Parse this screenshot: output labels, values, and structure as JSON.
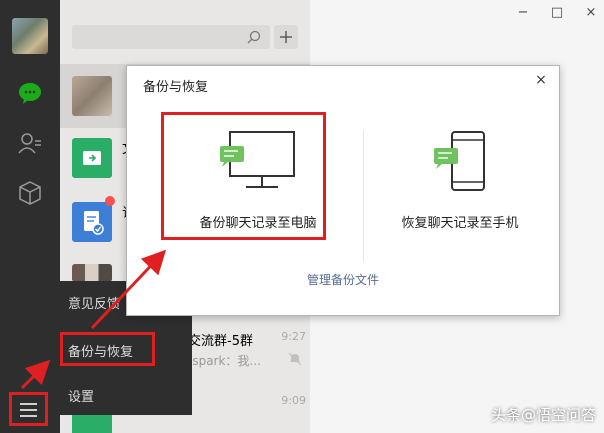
{
  "sidebar": {
    "icons": [
      "chat-icon",
      "contacts-icon",
      "favorites-icon",
      "menu-icon"
    ]
  },
  "conversations": [
    {
      "name": "",
      "preview": "",
      "time": ""
    },
    {
      "name": "文",
      "preview": "",
      "time": ""
    },
    {
      "name": "订",
      "preview": "",
      "time": ""
    },
    {
      "name": "",
      "preview": "",
      "time": ""
    },
    {
      "name": "交流群-5群",
      "preview": "-spark：我...",
      "time": "9:27"
    },
    {
      "name": "",
      "preview": "",
      "time": "9:09"
    }
  ],
  "popup_menu": {
    "items": [
      "意见反馈",
      "备份与恢复",
      "设置"
    ]
  },
  "dialog": {
    "title": "备份与恢复",
    "close": "×",
    "option_pc": "备份聊天记录至电脑",
    "option_phone": "恢复聊天记录至手机",
    "manage_link": "管理备份文件"
  },
  "window_controls": {
    "minimize": "−",
    "maximize": "□",
    "close": "×"
  },
  "watermark": "头条@悟空问答",
  "colors": {
    "accent": "#1aad19",
    "annotation": "#e02020",
    "link": "#576b95"
  }
}
